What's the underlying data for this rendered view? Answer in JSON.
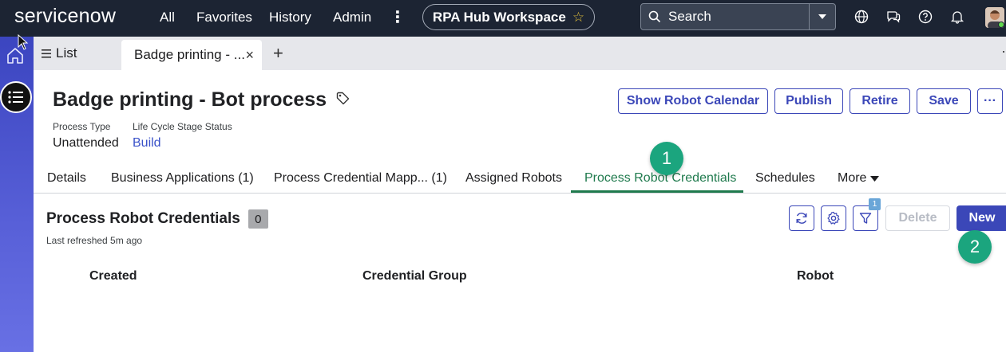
{
  "brand": {
    "logo_text_a": "service",
    "logo_text_b": "w"
  },
  "topnav": {
    "links": [
      "All",
      "Favorites",
      "History",
      "Admin"
    ],
    "more": "⋮",
    "workspace": "RPA Hub Workspace",
    "search_label": "Search"
  },
  "tabs": {
    "list_label": "List",
    "active_label": "Badge printing - ...",
    "close": "×",
    "add": "+",
    "overflow": "·"
  },
  "record": {
    "title": "Badge printing - Bot process",
    "fields": [
      {
        "label": "Process Type",
        "value": "Unattended"
      },
      {
        "label": "Life Cycle Stage Status",
        "value": "Build"
      }
    ],
    "actions": [
      "Show Robot Calendar",
      "Publish",
      "Retire",
      "Save",
      "···"
    ]
  },
  "related_tabs": {
    "items": [
      "Details",
      "Business Applications (1)",
      "Process Credential Mapp... (1)",
      "Assigned Robots",
      "Process Robot Credentials",
      "Schedules"
    ],
    "more": "More",
    "active_index": 4
  },
  "list": {
    "title": "Process Robot Credentials",
    "count": "0",
    "last_refreshed": "Last refreshed 5m ago",
    "filter_badge": "1",
    "delete_label": "Delete",
    "new_label": "New",
    "columns": [
      "Created",
      "Credential Group",
      "Robot"
    ]
  },
  "annotations": [
    "1",
    "2"
  ],
  "colors": {
    "topbar": "#1c2433",
    "primary": "#3b47b8",
    "active_tab": "#1f7a4d",
    "step_marker": "#1ba57e",
    "rail": "#4a53cc"
  }
}
